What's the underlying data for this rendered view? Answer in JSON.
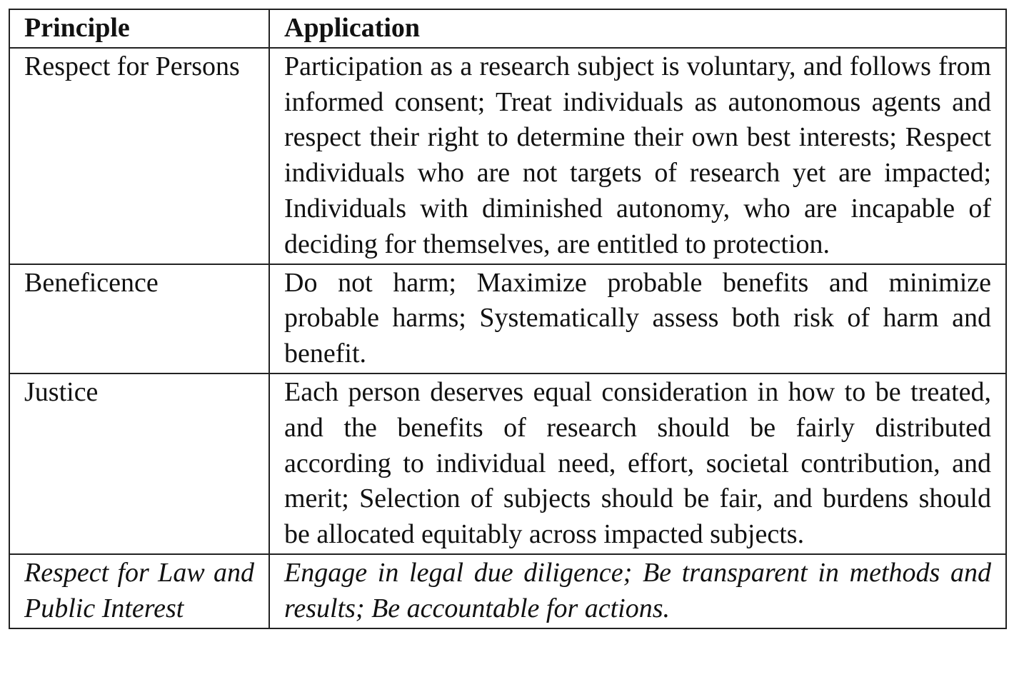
{
  "table": {
    "headers": {
      "principle": "Principle",
      "application": "Application"
    },
    "rows": [
      {
        "principle": "Respect for Persons",
        "application": "Participation as a research subject is voluntary, and follows from informed consent; Treat individuals as autonomous agents and respect their right to determine their own best in­terests; Respect individuals who are not targets of research yet are impacted; Individuals with diminished autonomy, who are incapable of deciding for themselves, are entitled to protection.",
        "italic": false
      },
      {
        "principle": "Beneficence",
        "application": "Do not harm; Maximize probable benefits and minimize probable harms; Systematically assess both risk of harm and benefit.",
        "italic": false
      },
      {
        "principle": "Justice",
        "application": "Each person deserves equal consideration in how to be treated, and the benefits of research should be fairly dis­tributed according to individual need, effort, societal con­tribution, and merit; Selection of subjects should be fair, and burdens should be allocated equitably across impacted sub­jects.",
        "italic": false
      },
      {
        "principle": "Respect for Law and Public Interest",
        "application": "Engage in legal due diligence; Be transparent in methods and results; Be accountable for actions.",
        "italic": true
      }
    ]
  }
}
